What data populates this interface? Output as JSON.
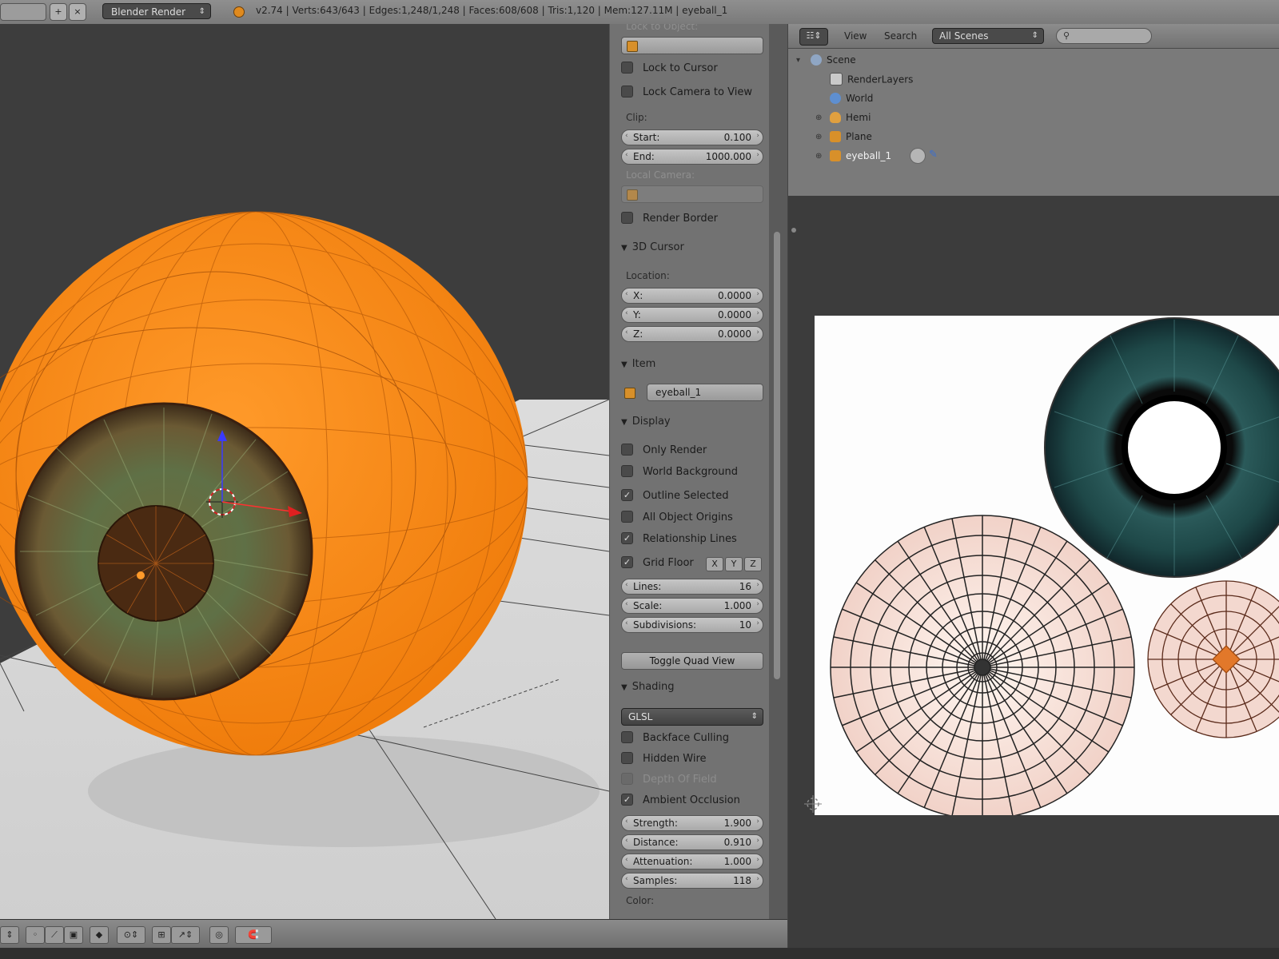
{
  "topbar": {
    "render_engine": "Blender Render",
    "info": "v2.74 | Verts:643/643 | Edges:1,248/1,248 | Faces:608/608 | Tris:1,120 | Mem:127.11M | eyeball_1"
  },
  "properties": {
    "lock_to_object_label": "Lock to Object:",
    "lock_to_cursor": "Lock to Cursor",
    "lock_camera_to_view": "Lock Camera to View",
    "clip_label": "Clip:",
    "clip_start_label": "Start:",
    "clip_start_value": "0.100",
    "clip_end_label": "End:",
    "clip_end_value": "1000.000",
    "local_camera_label": "Local Camera:",
    "render_border": "Render Border",
    "cursor_header": "3D Cursor",
    "location_label": "Location:",
    "cursor_x_label": "X:",
    "cursor_x_value": "0.0000",
    "cursor_y_label": "Y:",
    "cursor_y_value": "0.0000",
    "cursor_z_label": "Z:",
    "cursor_z_value": "0.0000",
    "item_header": "Item",
    "item_name": "eyeball_1",
    "display_header": "Display",
    "only_render": "Only Render",
    "world_background": "World Background",
    "outline_selected": "Outline Selected",
    "all_object_origins": "All Object Origins",
    "relationship_lines": "Relationship Lines",
    "grid_floor": "Grid Floor",
    "axis_x": "X",
    "axis_y": "Y",
    "axis_z": "Z",
    "lines_label": "Lines:",
    "lines_value": "16",
    "scale_label": "Scale:",
    "scale_value": "1.000",
    "subdivisions_label": "Subdivisions:",
    "subdivisions_value": "10",
    "toggle_quad_view": "Toggle Quad View",
    "shading_header": "Shading",
    "shading_mode": "GLSL",
    "backface_culling": "Backface Culling",
    "hidden_wire": "Hidden Wire",
    "depth_of_field": "Depth Of Field",
    "ambient_occlusion": "Ambient Occlusion",
    "strength_label": "Strength:",
    "strength_value": "1.900",
    "distance_label": "Distance:",
    "distance_value": "0.910",
    "attenuation_label": "Attenuation:",
    "attenuation_value": "1.000",
    "samples_label": "Samples:",
    "samples_value": "118",
    "color_label": "Color:"
  },
  "outliner": {
    "view_menu": "View",
    "search_menu": "Search",
    "scene_filter": "All Scenes",
    "tree": {
      "scene": "Scene",
      "render_layers": "RenderLayers",
      "world": "World",
      "hemi": "Hemi",
      "plane": "Plane",
      "eyeball": "eyeball_1"
    }
  },
  "colors": {
    "eyeball_orange": "#ff8a1a",
    "iris_green": "#5a6a3a",
    "iris_teal": "#1e4a4a",
    "ui_panel": "#727272"
  },
  "icons": [
    "camera-object-icon",
    "scene-icon",
    "render-layers-icon",
    "world-icon",
    "lamp-icon",
    "mesh-icon",
    "search-icon"
  ]
}
